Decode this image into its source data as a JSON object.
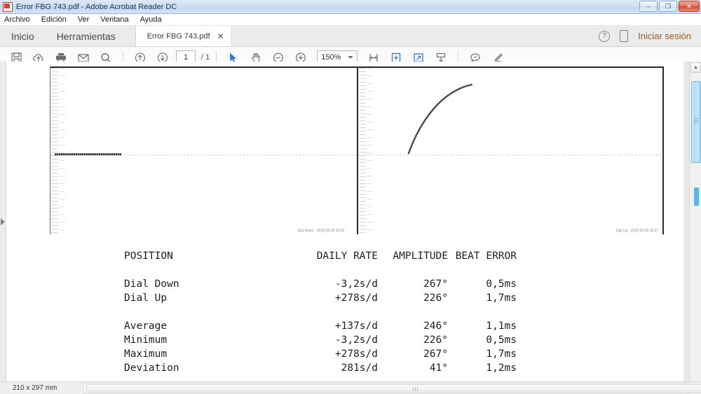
{
  "window": {
    "title": "Error FBG 743.pdf - Adobe Acrobat Reader DC",
    "app_icon": "pdf-document-icon",
    "minimize": "–",
    "maximize": "❐",
    "close": "✕"
  },
  "menu": {
    "items": [
      {
        "label": "Archivo"
      },
      {
        "label": "Edición"
      },
      {
        "label": "Ver"
      },
      {
        "label": "Ventana"
      },
      {
        "label": "Ayuda"
      }
    ]
  },
  "tabstrip": {
    "home_label": "Inicio",
    "tools_label": "Herramientas",
    "document_tab": "Error FBG 743.pdf",
    "document_tab_close": "✕",
    "help_icon": "?",
    "device_icon": "■",
    "signin_label": "Iniciar sesión",
    "signin_color": "#9a5b1e"
  },
  "toolbar": {
    "save_label": "save-icon",
    "cloud_label": "upload-to-cloud-icon",
    "print_label": "print-icon",
    "email_label": "email-icon",
    "search_label": "search-icon",
    "prev_page_label": "previous-page-icon",
    "next_page_label": "next-page-icon",
    "page_number": "1",
    "page_total": "/ 1",
    "select_tool": "cursor-icon",
    "hand_tool": "hand-icon",
    "zoom_out": "zoom-out-icon",
    "zoom_in": "zoom-in-icon",
    "zoom_level": "150%",
    "fit_width": "fit-width-icon",
    "fit_page": "fit-page-icon",
    "fullscreen": "fullscreen-icon",
    "scroll_mode": "scroll-mode-icon",
    "comment": "comment-icon",
    "highlight": "highlighter-icon"
  },
  "document": {
    "chart": {
      "left_caption": "Dial Down - 2016-05-20 11:06",
      "right_caption": "Dial Up - 2016-05-20 11:07"
    },
    "report": {
      "headers": {
        "position": "POSITION",
        "daily_rate": "DAILY RATE",
        "amplitude": "AMPLITUDE",
        "beat_error": "BEAT ERROR"
      },
      "measurements": [
        {
          "position": "Dial Down",
          "daily_rate": "-3,2s/d",
          "amplitude": "267°",
          "beat_error": "0,5ms"
        },
        {
          "position": "Dial Up",
          "daily_rate": "+278s/d",
          "amplitude": "226°",
          "beat_error": "1,7ms"
        }
      ],
      "summary": [
        {
          "position": "Average",
          "daily_rate": "+137s/d",
          "amplitude": "246°",
          "beat_error": "1,1ms"
        },
        {
          "position": "Minimum",
          "daily_rate": "-3,2s/d",
          "amplitude": "226°",
          "beat_error": "0,5ms"
        },
        {
          "position": "Maximum",
          "daily_rate": "+278s/d",
          "amplitude": "267°",
          "beat_error": "1,7ms"
        },
        {
          "position": "Deviation",
          "daily_rate": "281s/d",
          "amplitude": "41°",
          "beat_error": "1,2ms"
        }
      ]
    }
  },
  "statusbar": {
    "page_size": "210 x 297 mm",
    "scroll_left": "◄",
    "scroll_right": "►"
  },
  "navpane": {
    "expand_icon": "expand-navigation-pane-icon"
  },
  "scrollbar": {
    "up_arrow": "▲",
    "down_arrow": "▼"
  }
}
